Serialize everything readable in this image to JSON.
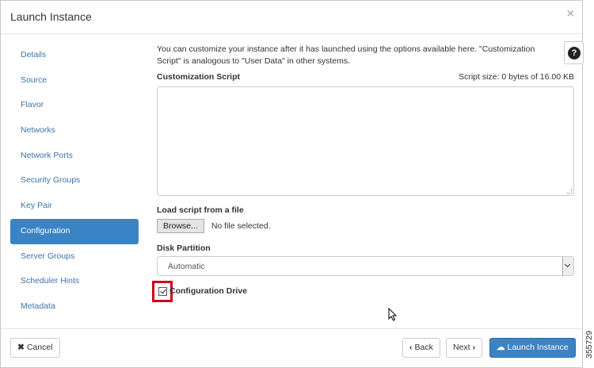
{
  "header": {
    "title": "Launch Instance",
    "close_glyph": "×"
  },
  "sidebar": {
    "items": [
      {
        "label": "Details"
      },
      {
        "label": "Source"
      },
      {
        "label": "Flavor"
      },
      {
        "label": "Networks"
      },
      {
        "label": "Network Ports"
      },
      {
        "label": "Security Groups"
      },
      {
        "label": "Key Pair"
      },
      {
        "label": "Configuration",
        "active": true
      },
      {
        "label": "Server Groups"
      },
      {
        "label": "Scheduler Hints"
      },
      {
        "label": "Metadata"
      }
    ]
  },
  "help": {
    "glyph": "?"
  },
  "main": {
    "description": "You can customize your instance after it has launched using the options available here. \"Customization Script\" is analogous to \"User Data\" in other systems.",
    "script_label": "Customization Script",
    "script_size": "Script size: 0 bytes of 16.00 KB",
    "script_value": "",
    "load_label": "Load script from a file",
    "browse_label": "Browse...",
    "file_status": "No file selected.",
    "disk_label": "Disk Partition",
    "disk_value": "Automatic",
    "config_drive_label": "Configuration Drive",
    "config_drive_checked": true
  },
  "footer": {
    "cancel_icon": "✖",
    "cancel_label": "Cancel",
    "back_icon": "‹",
    "back_label": "Back",
    "next_label": "Next",
    "next_icon": "›",
    "launch_icon": "☁",
    "launch_label": "Launch Instance"
  },
  "figure_number": "355729",
  "colors": {
    "accent": "#3a83c4",
    "link": "#3c74a8",
    "highlight": "#d0021b"
  }
}
